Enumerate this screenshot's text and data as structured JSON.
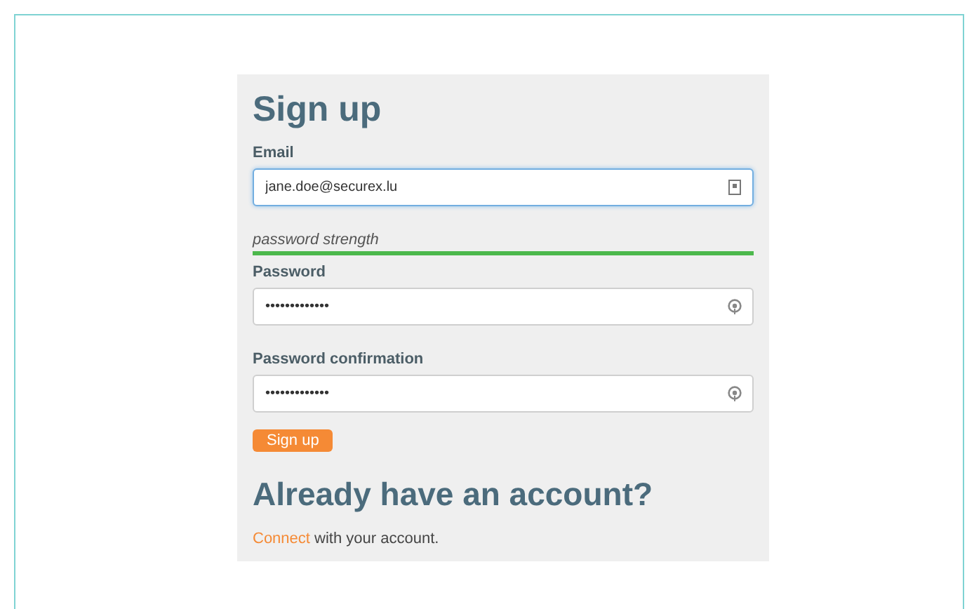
{
  "title": "Sign up",
  "fields": [
    {
      "kind": "email",
      "label": "Email",
      "value": "jane.doe@securex.lu",
      "focused": true
    },
    {
      "kind": "strength",
      "label": "password strength",
      "level": 1
    },
    {
      "kind": "password",
      "label": "Password",
      "value": "•••••••••••••",
      "focused": false
    },
    {
      "kind": "password",
      "label": "Password confirmation",
      "value": "•••••••••••••",
      "focused": false
    }
  ],
  "submit": "Sign up",
  "login": {
    "heading": "Already have an account?",
    "link": "Connect",
    "text": "with your account."
  }
}
